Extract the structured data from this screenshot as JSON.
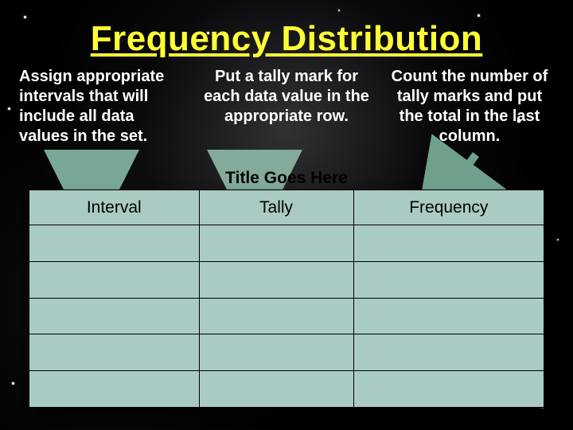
{
  "title": "Frequency Distribution",
  "blurbs": {
    "left": "Assign appropriate intervals that will include all data values in the set.",
    "mid": "Put a tally mark for each data value in the appropriate row.",
    "right": "Count the number of tally marks and put the total in the last column."
  },
  "table": {
    "title": "Title Goes Here",
    "headers": [
      "Interval",
      "Tally",
      "Frequency"
    ],
    "body_rows": 5
  },
  "colors": {
    "title": "#ffff33",
    "text": "#ffffff",
    "table_fill": "#a9cbc3",
    "arrow_left": "#7aa896",
    "arrow_mid": "#82ab9b",
    "arrow_right": "#6fa18d"
  }
}
